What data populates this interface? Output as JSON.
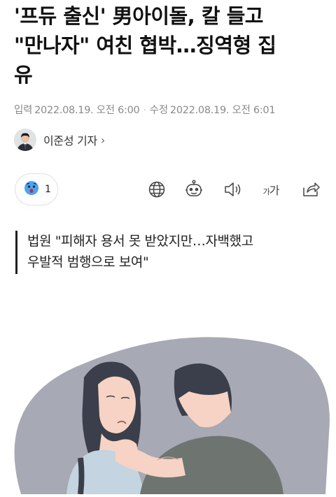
{
  "headline": {
    "line1": "'프듀 출신' 男아이돌, 칼 들고",
    "line2": "\"만나자\" 여친 협박…징역형 집",
    "line3": "유"
  },
  "meta": {
    "input_label": "입력",
    "input_time": "2022.08.19. 오전 6:00",
    "edit_label": "수정",
    "edit_time": "2022.08.19. 오전 6:01"
  },
  "author": {
    "name": "이준성 기자",
    "chevron": "›"
  },
  "reaction": {
    "icon": "surprised-face-icon",
    "count": "1"
  },
  "toolbar": {
    "icons": [
      "globe-icon",
      "robot-icon",
      "speaker-icon",
      "font-size-icon",
      "share-icon"
    ],
    "font_small": "가",
    "font_large": "가"
  },
  "subheading": {
    "line1": "법원 \"피해자 용서 못 받았지만…자백했고",
    "line2": "우발적 범행으로 보여\""
  },
  "colors": {
    "illustration_bg": "#a7a9b4",
    "jacket": "#6e7570",
    "hair": "#3a3f4b",
    "skin": "#f6d3c4",
    "top": "#c4d4e0"
  }
}
